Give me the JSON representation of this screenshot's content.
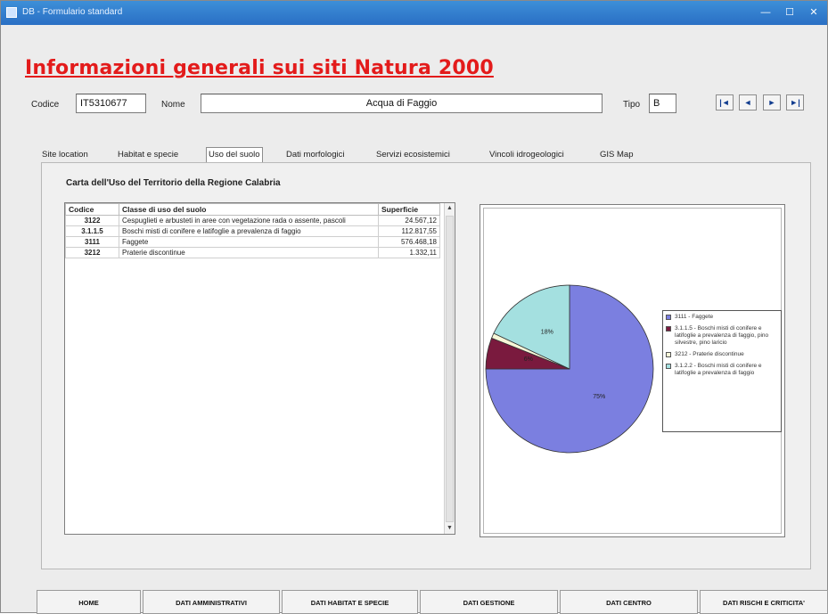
{
  "window": {
    "title": "DB - Formulario standard",
    "minimize": "—",
    "maximize": "☐",
    "close": "✕"
  },
  "heading": "Informazioni generali sui siti Natura 2000",
  "header": {
    "codice_label": "Codice",
    "codice_value": "IT5310677",
    "nome_label": "Nome",
    "nome_value": "Acqua di Faggio",
    "tipo_label": "Tipo",
    "tipo_value": "B",
    "nav": [
      "|◄",
      "◄",
      "►",
      "►|"
    ]
  },
  "tabs": [
    {
      "label": "Site location"
    },
    {
      "label": "Habitat e specie"
    },
    {
      "label": "Uso del suolo",
      "active": true
    },
    {
      "label": "Dati morfologici"
    },
    {
      "label": "Servizi ecosistemici"
    },
    {
      "label": "Vincoli idrogeologici"
    },
    {
      "label": "GIS Map"
    }
  ],
  "section_title": "Carta dell'Uso del Territorio della Regione Calabria",
  "table": {
    "columns": [
      "Codice",
      "Classe di uso del suolo",
      "Superficie"
    ],
    "rows": [
      [
        "3122",
        "Cespuglieti e arbusteti in aree con vegetazione rada o assente, pascoli",
        "24.567,12"
      ],
      [
        "3.1.1.5",
        "Boschi misti di conifere e latifoglie a prevalenza di faggio",
        "112.817,55"
      ],
      [
        "3111",
        "Faggete",
        "576.468,18"
      ],
      [
        "3212",
        "Praterie discontinue",
        "1.332,11"
      ]
    ]
  },
  "chart_data": {
    "type": "pie",
    "categories": [
      "3111 - Faggete",
      "3.1.1.5 - Boschi misti di conifere e latifoglie a prevalenza di faggio, pino silvestre, pino laricio",
      "3212 - Praterie discontinue",
      "3.1.2.2 - Boschi misti di conifere e latifoglie a prevalenza di faggio"
    ],
    "values": [
      75,
      6,
      1,
      18
    ],
    "colors": [
      "#7b7fe0",
      "#7a1a3e",
      "#f7f7d8",
      "#a4e0e0"
    ],
    "labels": [
      "75%",
      "6%",
      "1%",
      "18%"
    ],
    "legend_position": "right"
  },
  "bottom_tabs": [
    "HOME",
    "DATI AMMINISTRATIVI",
    "DATI HABITAT E SPECIE",
    "DATI GESTIONE",
    "DATI CENTRO",
    "DATI RISCHI E CRITICITA'"
  ]
}
